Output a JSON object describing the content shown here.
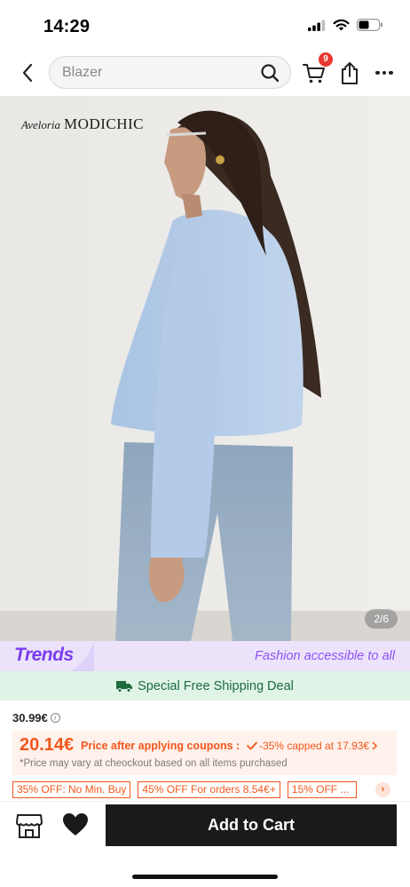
{
  "status_bar": {
    "time": "14:29",
    "icons": [
      "cellular-signal-icon",
      "wifi-icon",
      "battery-icon"
    ]
  },
  "nav": {
    "search_placeholder": "Blazer",
    "cart_count": "9",
    "icons": [
      "back-chevron-icon",
      "search-icon",
      "cart-icon",
      "share-icon",
      "more-icon"
    ]
  },
  "product_image": {
    "brand_prefix": "Aveloria",
    "brand_name": "MODICHIC",
    "counter": "2/6"
  },
  "trends": {
    "logo": "Trends",
    "tagline": "Fashion accessible to all"
  },
  "shipping": {
    "text": "Special Free Shipping Deal",
    "icon": "truck-icon"
  },
  "price": {
    "original": "30.99€",
    "discounted": "20.14€",
    "coupon_label": "Price after applying coupons :",
    "coupon_detail": "-35% capped at 17.93€",
    "note": "*Price may vary at cheockout based on all items purchased"
  },
  "promos": [
    "35% OFF: No Min. Buy",
    "45% OFF For orders 8.54€+",
    "15% OFF ..."
  ],
  "bottom": {
    "add_to_cart": "Add to Cart"
  },
  "colors": {
    "accent_orange": "#f2571c",
    "trends_purple": "#7b3df0",
    "shipping_green": "#1f6b3e",
    "badge_red": "#e8382f",
    "cta_black": "#1a1a1a"
  }
}
